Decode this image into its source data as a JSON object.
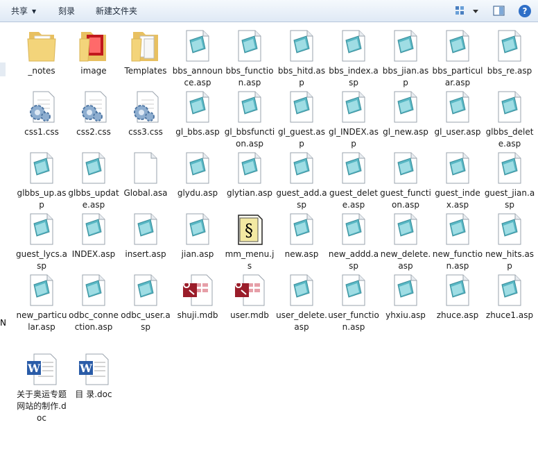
{
  "toolbar": {
    "share": "共享",
    "burn": "刻录",
    "new_folder": "新建文件夹",
    "help": "?"
  },
  "left_fragment": "N",
  "files": [
    {
      "name": "_notes",
      "icon": "folder"
    },
    {
      "name": "image",
      "icon": "folder-image"
    },
    {
      "name": "Templates",
      "icon": "folder-doc"
    },
    {
      "name": "bbs_announce.asp",
      "icon": "asp-file"
    },
    {
      "name": "bbs_function.asp",
      "icon": "asp-file"
    },
    {
      "name": "bbs_hitd.asp",
      "icon": "asp-file"
    },
    {
      "name": "bbs_index.asp",
      "icon": "asp-file"
    },
    {
      "name": "bbs_jian.asp",
      "icon": "asp-file"
    },
    {
      "name": "bbs_particular.asp",
      "icon": "asp-file"
    },
    {
      "name": "bbs_re.asp",
      "icon": "asp-file"
    },
    {
      "name": "css1.css",
      "icon": "css-file"
    },
    {
      "name": "css2.css",
      "icon": "css-file"
    },
    {
      "name": "css3.css",
      "icon": "css-file"
    },
    {
      "name": "gl_bbs.asp",
      "icon": "asp-file"
    },
    {
      "name": "gl_bbsfunction.asp",
      "icon": "asp-file"
    },
    {
      "name": "gl_guest.asp",
      "icon": "asp-file"
    },
    {
      "name": "gl_INDEX.asp",
      "icon": "asp-file"
    },
    {
      "name": "gl_new.asp",
      "icon": "asp-file"
    },
    {
      "name": "gl_user.asp",
      "icon": "asp-file"
    },
    {
      "name": "glbbs_delete.asp",
      "icon": "asp-file"
    },
    {
      "name": "glbbs_up.asp",
      "icon": "asp-file"
    },
    {
      "name": "glbbs_update.asp",
      "icon": "asp-file"
    },
    {
      "name": "Global.asa",
      "icon": "blank-file"
    },
    {
      "name": "glydu.asp",
      "icon": "asp-file"
    },
    {
      "name": "glytian.asp",
      "icon": "asp-file"
    },
    {
      "name": "guest_add.asp",
      "icon": "asp-file"
    },
    {
      "name": "guest_delete.asp",
      "icon": "asp-file"
    },
    {
      "name": "guest_function.asp",
      "icon": "asp-file"
    },
    {
      "name": "guest_index.asp",
      "icon": "asp-file"
    },
    {
      "name": "guest_jian.asp",
      "icon": "asp-file"
    },
    {
      "name": "guest_lycs.asp",
      "icon": "asp-file"
    },
    {
      "name": "INDEX.asp",
      "icon": "asp-file"
    },
    {
      "name": "insert.asp",
      "icon": "asp-file"
    },
    {
      "name": "jian.asp",
      "icon": "asp-file"
    },
    {
      "name": "mm_menu.js",
      "icon": "js-file"
    },
    {
      "name": "new.asp",
      "icon": "asp-file"
    },
    {
      "name": "new_addd.asp",
      "icon": "asp-file"
    },
    {
      "name": "new_delete.asp",
      "icon": "asp-file"
    },
    {
      "name": "new_function.asp",
      "icon": "asp-file"
    },
    {
      "name": "new_hits.asp",
      "icon": "asp-file"
    },
    {
      "name": "new_particular.asp",
      "icon": "asp-file"
    },
    {
      "name": "odbc_connection.asp",
      "icon": "asp-file"
    },
    {
      "name": "odbc_user.asp",
      "icon": "asp-file"
    },
    {
      "name": "shuji.mdb",
      "icon": "mdb-file"
    },
    {
      "name": "user.mdb",
      "icon": "mdb-file"
    },
    {
      "name": "user_delete.asp",
      "icon": "asp-file"
    },
    {
      "name": "user_function.asp",
      "icon": "asp-file"
    },
    {
      "name": "yhxiu.asp",
      "icon": "asp-file"
    },
    {
      "name": "zhuce.asp",
      "icon": "asp-file"
    },
    {
      "name": "zhuce1.asp",
      "icon": "asp-file"
    },
    {
      "name": "关于奥运专题网站的制作.doc",
      "icon": "doc-file"
    },
    {
      "name": "目 录.doc",
      "icon": "doc-file"
    }
  ]
}
